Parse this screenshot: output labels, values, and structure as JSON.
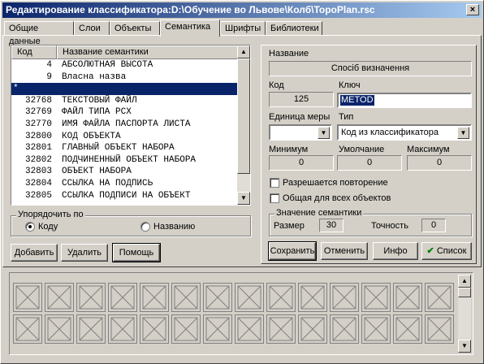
{
  "window": {
    "title": "Редактирование классификатора:D:\\Обучение во Львове\\Колб\\TopoPlan.rsc",
    "close_symbol": "×"
  },
  "tabs": [
    {
      "label": "Общие данные"
    },
    {
      "label": "Слои"
    },
    {
      "label": "Объекты"
    },
    {
      "label": "Семантика"
    },
    {
      "label": "Шрифты"
    },
    {
      "label": "Библиотеки"
    }
  ],
  "semantics_list": {
    "col_code": "Код",
    "col_name": "Название семантики",
    "rows": [
      {
        "code": "4",
        "name": "АБСОЛЮТНАЯ ВЫСОТА"
      },
      {
        "code": "9",
        "name": "Власна назва"
      },
      {
        "code": "*",
        "name": ""
      },
      {
        "code": "32768",
        "name": "ТЕКСТОВЫЙ ФАЙЛ"
      },
      {
        "code": "32769",
        "name": "ФАЙЛ ТИПА РСХ"
      },
      {
        "code": "32770",
        "name": "ИМЯ ФАЙЛА ПАСПОРТА ЛИСТА"
      },
      {
        "code": "32800",
        "name": "КОД ОБЪЕКТА"
      },
      {
        "code": "32801",
        "name": "ГЛАВНЫЙ ОБЪЕКТ НАБОРА"
      },
      {
        "code": "32802",
        "name": "ПОДЧИНЕННЫЙ ОБЪЕКТ НАБОРА"
      },
      {
        "code": "32803",
        "name": "ОБЪЕКТ НАБОРА"
      },
      {
        "code": "32804",
        "name": "ССЫЛКА НА ПОДПИСЬ"
      },
      {
        "code": "32805",
        "name": "ССЫЛКА ПОДПИСИ НА ОБЪЕКТ"
      }
    ],
    "selected_index": 2
  },
  "sort": {
    "title": "Упорядочить по",
    "by_code": "Коду",
    "by_name": "Названию",
    "selected": "code"
  },
  "left_buttons": {
    "add": "Добавить",
    "delete": "Удалить",
    "help": "Помощь"
  },
  "details": {
    "name_label": "Название",
    "name_value": "Спосіб визначення",
    "code_label": "Код",
    "code_value": "125",
    "key_label": "Ключ",
    "key_value": "METOD",
    "unit_label": "Единица меры",
    "unit_value": "",
    "type_label": "Тип",
    "type_value": "Код из классификатора",
    "min_label": "Минимум",
    "min_value": "0",
    "default_label": "Умолчание",
    "default_value": "0",
    "max_label": "Максимум",
    "max_value": "0",
    "repeat_label": "Разрешается повторение",
    "repeat_checked": false,
    "common_label": "Общая для всех объектов",
    "common_checked": false,
    "value_group_title": "Значение семантики",
    "size_label": "Размер",
    "size_value": "30",
    "precision_label": "Точность",
    "precision_value": "0"
  },
  "right_buttons": {
    "save": "Сохранить",
    "cancel": "Отменить",
    "info": "Инфо",
    "list": "Список"
  },
  "colors": {
    "selection": "#0a246a",
    "face": "#d4d0c8",
    "list_ok_check": "#008000"
  }
}
